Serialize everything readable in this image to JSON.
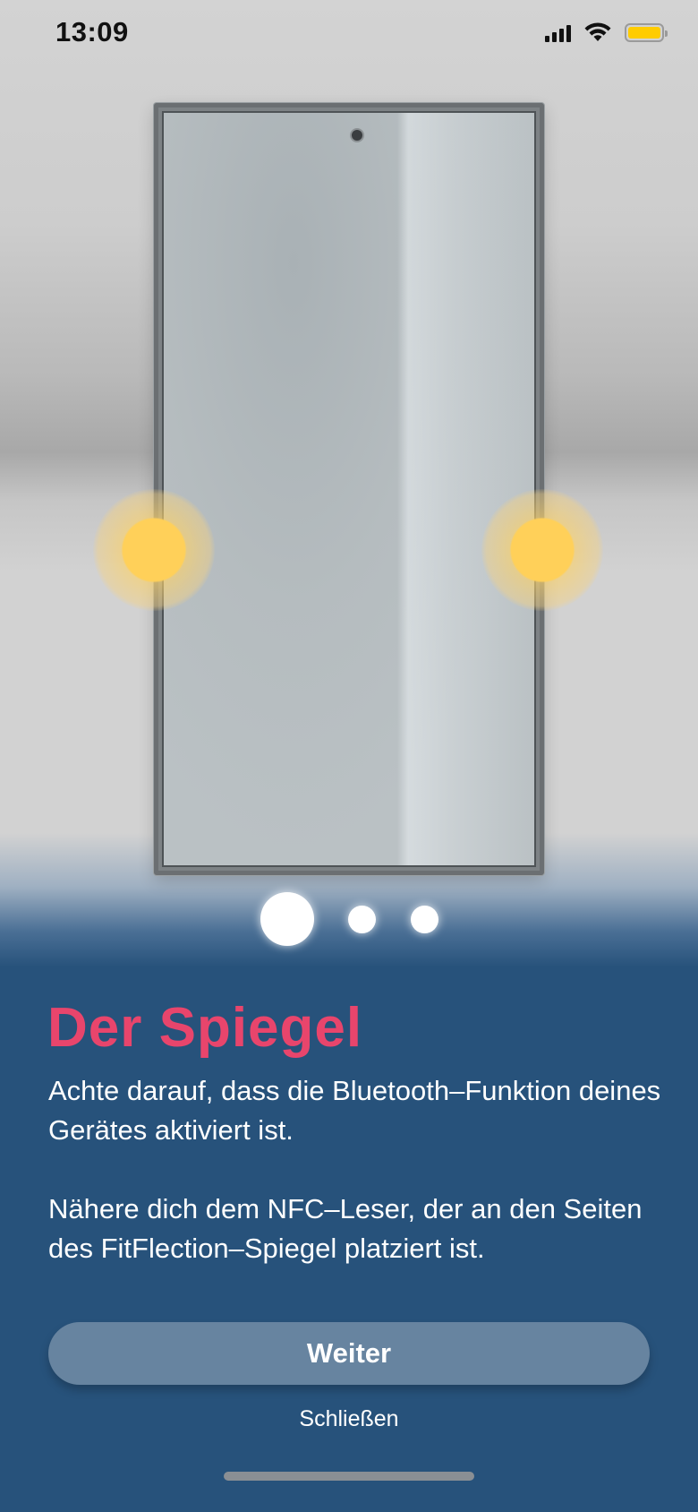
{
  "status_bar": {
    "time": "13:09",
    "icons": [
      "cellular-signal-icon",
      "wifi-icon",
      "battery-icon"
    ],
    "battery_color": "#ffcc00"
  },
  "illustration": {
    "subject": "phone-mirror-icon",
    "marker_color": "#ffd059"
  },
  "pager": {
    "total": 3,
    "active": 1
  },
  "content": {
    "title": "Der Spiegel",
    "paragraph1": "Achte darauf, dass die Bluetooth–Funktion deines Gerätes aktiviert ist.",
    "paragraph2": "Nähere dich dem NFC–Leser, der an den Seiten des FitFlection–Spiegel platziert ist."
  },
  "actions": {
    "next_label": "Weiter",
    "close_label": "Schließen"
  },
  "colors": {
    "title": "#e8456c",
    "background": "#27527b",
    "button": "#6784a0"
  }
}
